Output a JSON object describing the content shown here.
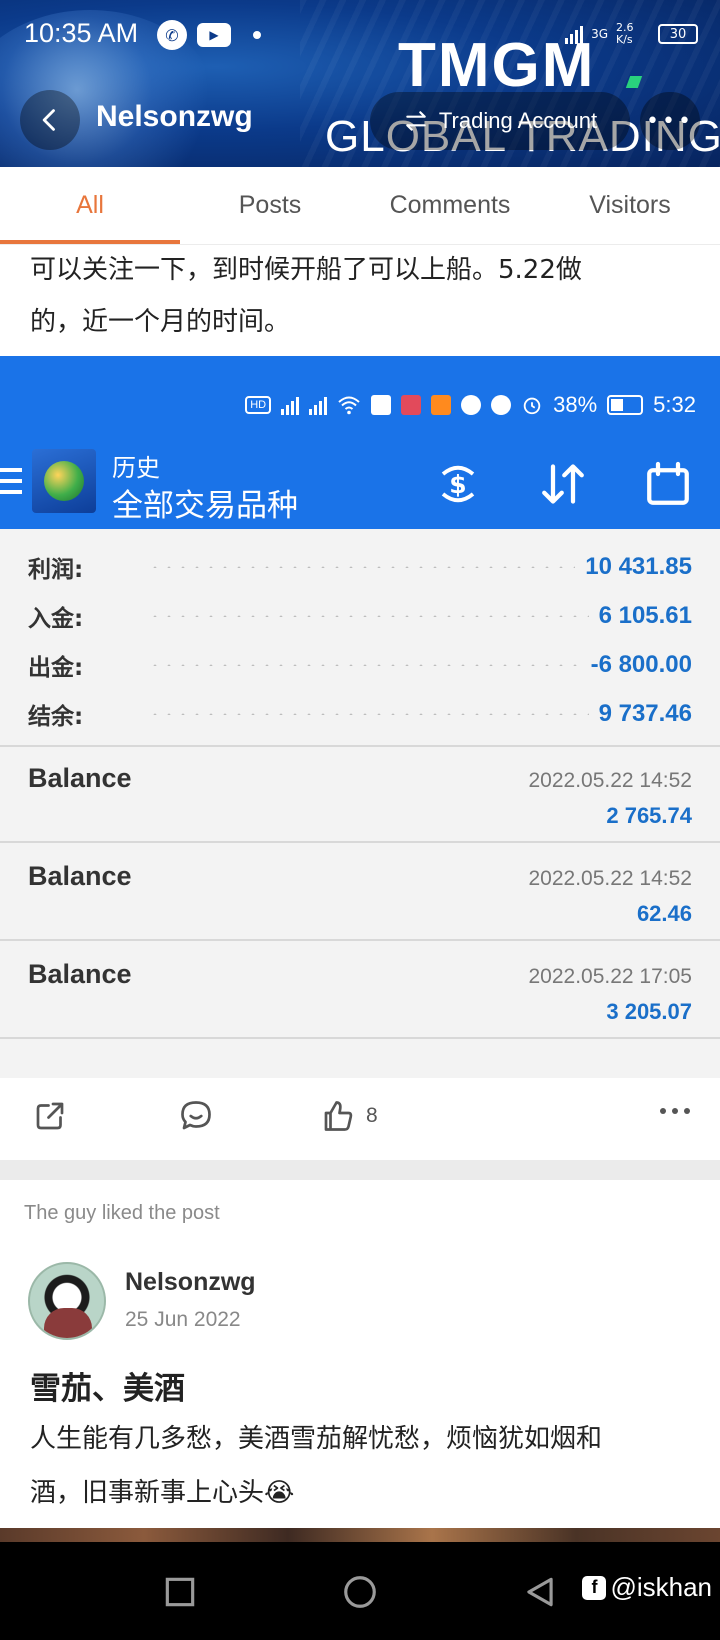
{
  "status_bar": {
    "time": "10:35 AM",
    "network_label": "3G",
    "speed": "2.6 K/s",
    "battery": "30"
  },
  "header": {
    "profile_name": "Nelsonzwg",
    "trading_account_label": "Trading Account",
    "brand": "TMGM",
    "brand_sub": "GLOBAL TRADING"
  },
  "tabs": [
    {
      "label": "All",
      "active": true
    },
    {
      "label": "Posts",
      "active": false
    },
    {
      "label": "Comments",
      "active": false
    },
    {
      "label": "Visitors",
      "active": false
    }
  ],
  "post": {
    "text_line_1": "可以关注一下，到时候开船了可以上船。5.22做",
    "text_line_2": "的，近一个月的时间。",
    "like_count": "8"
  },
  "mt4": {
    "status_battery": "38%",
    "status_time": "5:32",
    "section": "历史",
    "filter": "全部交易品种",
    "summary": [
      {
        "label": "利润:",
        "value": "10 431.85"
      },
      {
        "label": "入金:",
        "value": "6 105.61"
      },
      {
        "label": "出金:",
        "value": "-6 800.00"
      },
      {
        "label": "结余:",
        "value": "9 737.46"
      }
    ],
    "deals": [
      {
        "type": "Balance",
        "time": "2022.05.22 14:52",
        "amount": "2 765.74"
      },
      {
        "type": "Balance",
        "time": "2022.05.22 14:52",
        "amount": "62.46"
      },
      {
        "type": "Balance",
        "time": "2022.05.22 17:05",
        "amount": "3 205.07"
      }
    ]
  },
  "activity": {
    "label": "The guy liked the post",
    "name": "Nelsonzwg",
    "date": "25 Jun 2022",
    "title": "雪茄、美酒",
    "body_line_1": "人生能有几多愁，美酒雪茄解忧愁，烦恼犹如烟和",
    "body_line_2": "酒，旧事新事上心头😭"
  },
  "watermark": "@iskhan",
  "colors": {
    "accent_orange": "#e8763c",
    "mt4_blue": "#1a73e8",
    "value_blue": "#1a6fc9"
  }
}
